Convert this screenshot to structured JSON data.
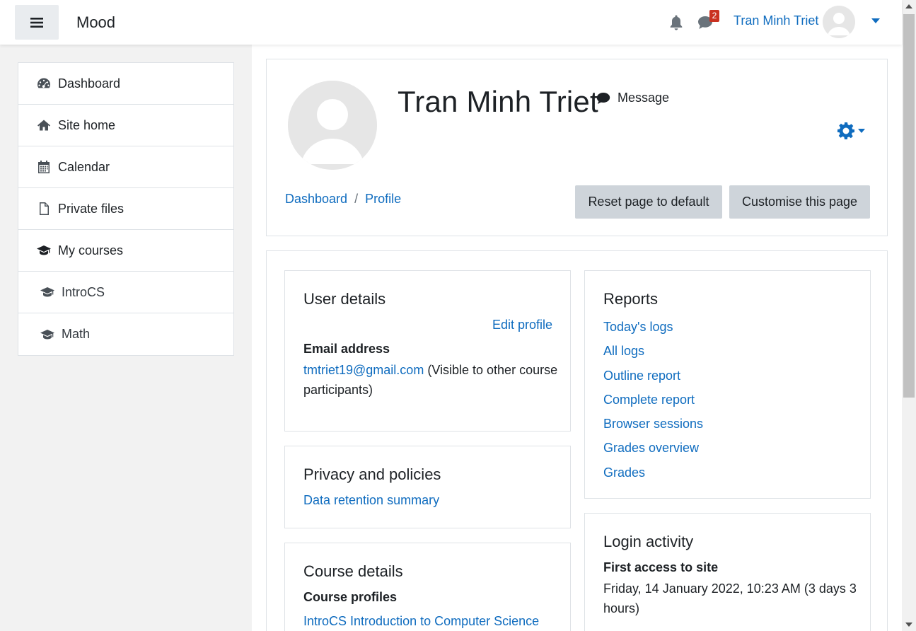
{
  "navbar": {
    "brand": "Mood",
    "notification_count": "2",
    "user_name": "Tran Minh Triet"
  },
  "drawer": {
    "items": [
      {
        "label": "Dashboard",
        "icon": "dashboard-icon"
      },
      {
        "label": "Site home",
        "icon": "home-icon"
      },
      {
        "label": "Calendar",
        "icon": "calendar-icon"
      },
      {
        "label": "Private files",
        "icon": "file-icon"
      },
      {
        "label": "My courses",
        "icon": "graduation-cap-icon"
      },
      {
        "label": "IntroCS",
        "icon": "graduation-cap-icon"
      },
      {
        "label": "Math",
        "icon": "graduation-cap-icon"
      }
    ]
  },
  "header": {
    "name": "Tran Minh Triet",
    "message_label": "Message",
    "breadcrumb": [
      "Dashboard",
      "Profile"
    ],
    "breadcrumb_separator": "/",
    "reset_button": "Reset page to default",
    "customise_button": "Customise this page"
  },
  "user_details": {
    "title": "User details",
    "edit_profile": "Edit profile",
    "email_label": "Email address",
    "email": "tmtriet19@gmail.com",
    "email_note": " (Visible to other course participants)"
  },
  "privacy": {
    "title": "Privacy and policies",
    "link": "Data retention summary"
  },
  "course_details": {
    "title": "Course details",
    "label": "Course profiles",
    "link": "IntroCS Introduction to Computer Science"
  },
  "reports": {
    "title": "Reports",
    "links": [
      "Today's logs",
      "All logs",
      "Outline report",
      "Complete report",
      "Browser sessions",
      "Grades overview",
      "Grades"
    ]
  },
  "login_activity": {
    "title": "Login activity",
    "label": "First access to site",
    "value": "Friday, 14 January 2022, 10:23 AM  (3 days 3 hours)"
  },
  "colors": {
    "link": "#0f6cbf",
    "badge": "#ca3120",
    "button": "#ced4da"
  }
}
